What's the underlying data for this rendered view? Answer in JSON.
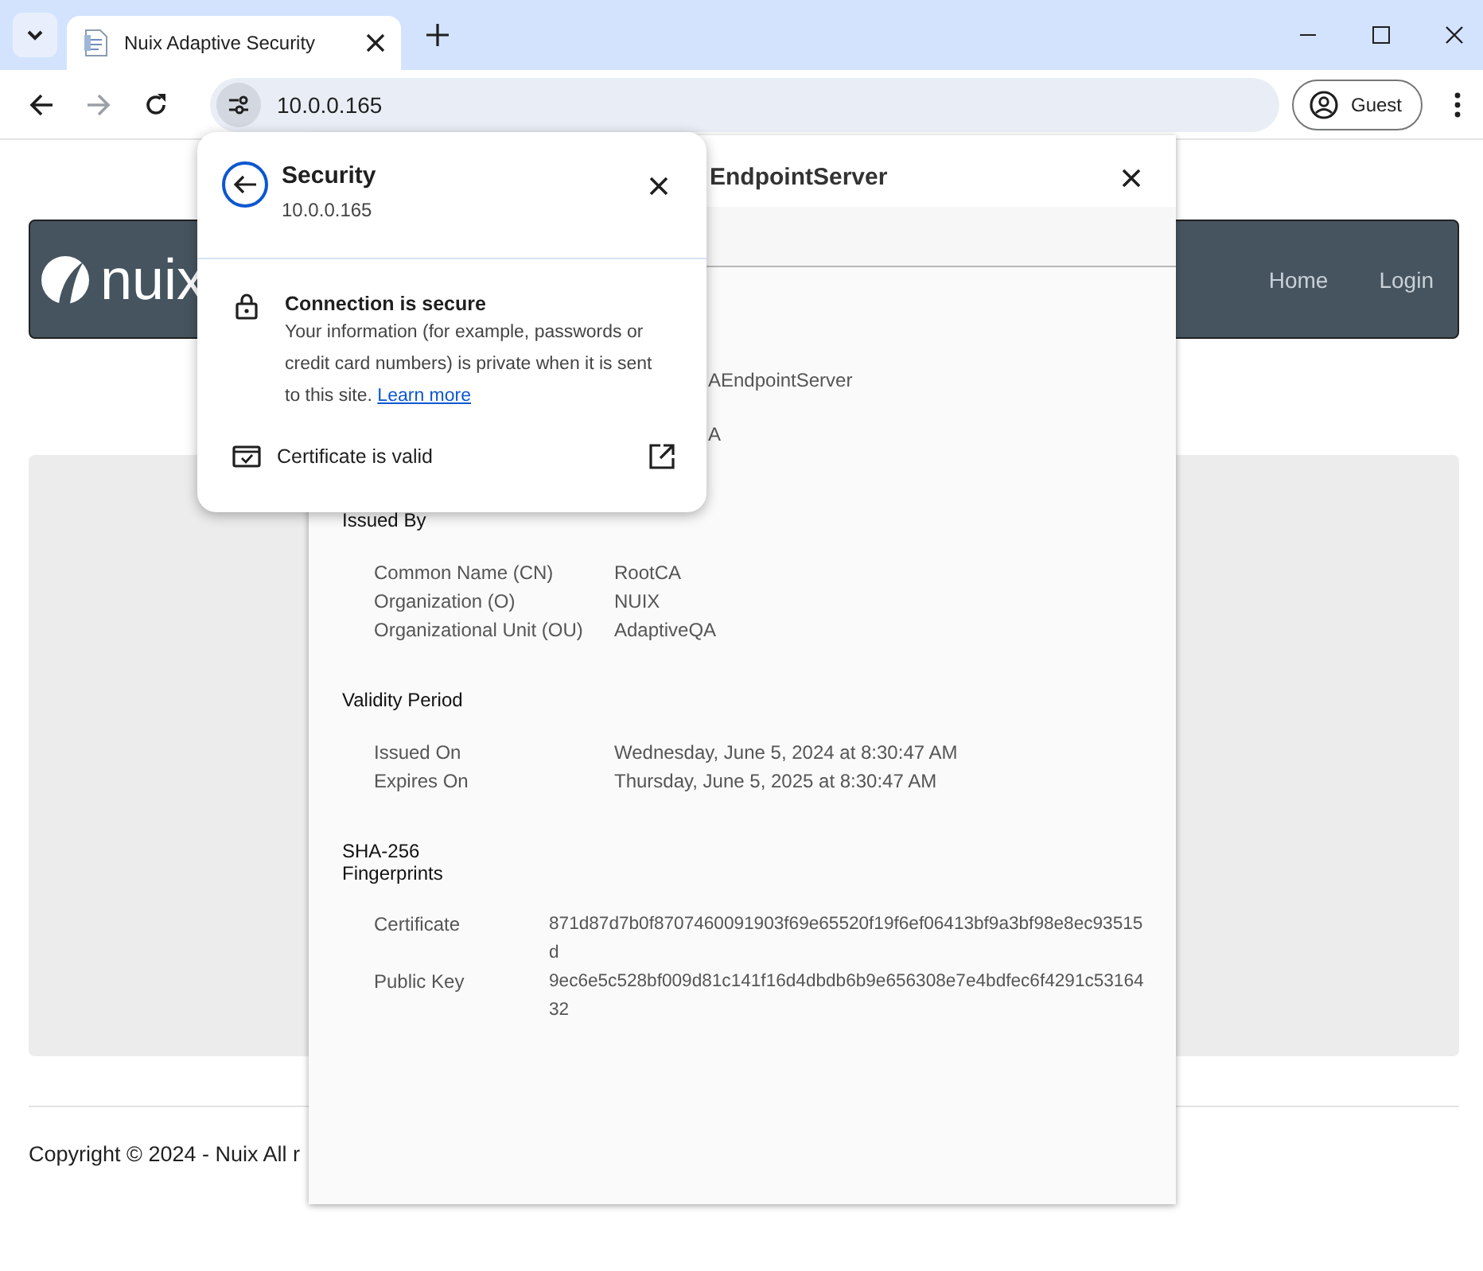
{
  "browser": {
    "tabs": [
      {
        "title": "Nuix Adaptive Security",
        "selected": true
      }
    ],
    "address": "10.0.0.165",
    "profile": "Guest"
  },
  "page": {
    "logo": "nuix",
    "nav_links": [
      "Home",
      "Login"
    ],
    "footer": "Copyright © 2024 - Nuix All r"
  },
  "certificate_viewer": {
    "title": "EndpointServer",
    "partial_values": [
      "AEndpointServer",
      "A"
    ],
    "sections": [
      {
        "heading": "Issued By",
        "kind": "fields",
        "rows": [
          {
            "label": "Common Name (CN)",
            "value": "RootCA"
          },
          {
            "label": "Organization (O)",
            "value": "NUIX"
          },
          {
            "label": "Organizational Unit (OU)",
            "value": "AdaptiveQA"
          }
        ]
      },
      {
        "heading": "Validity Period",
        "kind": "fields",
        "rows": [
          {
            "label": "Issued On",
            "value": "Wednesday, June 5, 2024 at 8:30:47 AM"
          },
          {
            "label": "Expires On",
            "value": "Thursday, June 5, 2025 at 8:30:47 AM"
          }
        ]
      },
      {
        "heading": "SHA-256 Fingerprints",
        "kind": "hashes",
        "rows": [
          {
            "label": "Certificate",
            "value": "871d87d7b0f8707460091903f69e65520f19f6ef06413bf9a3bf98e8ec93515d"
          },
          {
            "label": "Public Key",
            "value": "9ec6e5c528bf009d81c141f16d4dbdb6b9e656308e7e4bdfec6f4291c5316432"
          }
        ]
      }
    ]
  },
  "site_info": {
    "title": "Security",
    "host": "10.0.0.165",
    "connection_title": "Connection is secure",
    "connection_text": "Your information (for example, passwords or credit card numbers) is private when it is sent to this site. ",
    "link": "Learn more",
    "certificate": "Certificate is valid"
  }
}
